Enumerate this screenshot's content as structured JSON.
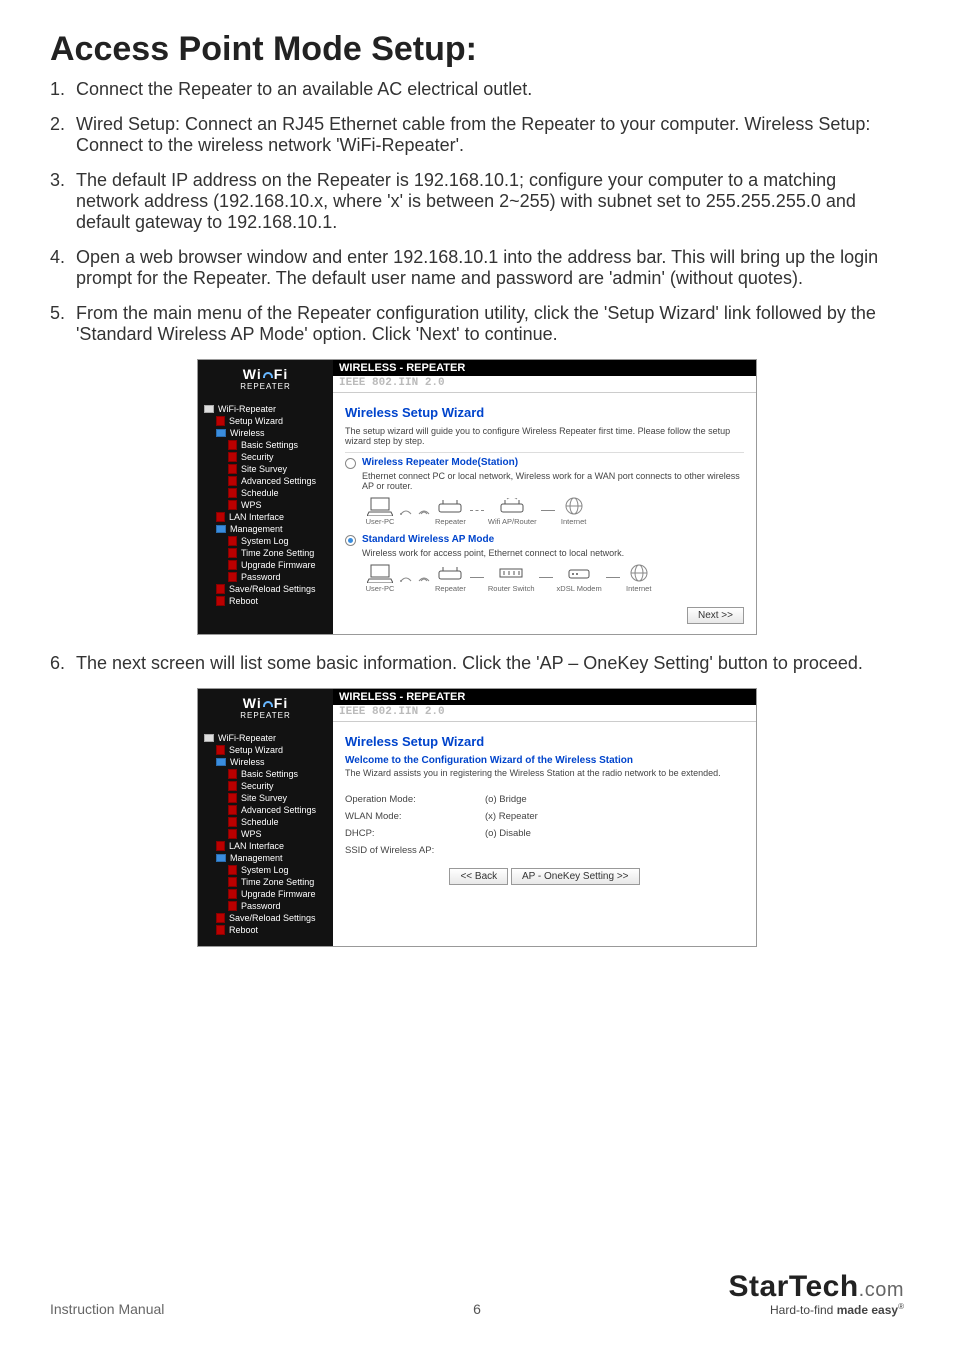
{
  "heading": "Access Point Mode Setup:",
  "steps": [
    "Connect the Repeater to an available AC electrical outlet.",
    "Wired Setup: Connect an RJ45 Ethernet cable from the Repeater to your computer. Wireless Setup: Connect to the wireless network 'WiFi-Repeater'.",
    "The default IP address on the Repeater is 192.168.10.1; configure your computer to a matching network address (192.168.10.x, where 'x' is between 2~255) with subnet set to 255.255.255.0 and default gateway to 192.168.10.1.",
    "Open a web browser window and enter 192.168.10.1 into the address bar.  This will bring up the login prompt for the Repeater.  The default user name and password are 'admin' (without quotes).",
    "From the main menu of the Repeater configuration utility, click the 'Setup Wizard' link followed by the 'Standard Wireless AP Mode' option.  Click 'Next' to continue.",
    "The next screen will list some basic information.  Click the 'AP – OneKey Setting' button to proceed."
  ],
  "router_ui": {
    "logo_top": "Wi Fi",
    "logo_bottom": "REPEATER",
    "header_top": "WIRELESS - REPEATER",
    "header_sub": "IEEE 802.IIN 2.0",
    "nav": {
      "root": "WiFi-Repeater",
      "items": [
        {
          "label": "Setup Wizard",
          "lvl": 2,
          "icon": "file"
        },
        {
          "label": "Wireless",
          "lvl": 2,
          "icon": "folder"
        },
        {
          "label": "Basic Settings",
          "lvl": 3,
          "icon": "file"
        },
        {
          "label": "Security",
          "lvl": 3,
          "icon": "file"
        },
        {
          "label": "Site Survey",
          "lvl": 3,
          "icon": "file"
        },
        {
          "label": "Advanced Settings",
          "lvl": 3,
          "icon": "file"
        },
        {
          "label": "Schedule",
          "lvl": 3,
          "icon": "file"
        },
        {
          "label": "WPS",
          "lvl": 3,
          "icon": "file"
        },
        {
          "label": "LAN Interface",
          "lvl": 2,
          "icon": "file"
        },
        {
          "label": "Management",
          "lvl": 2,
          "icon": "folder"
        },
        {
          "label": "System Log",
          "lvl": 3,
          "icon": "file"
        },
        {
          "label": "Time Zone Setting",
          "lvl": 3,
          "icon": "file"
        },
        {
          "label": "Upgrade Firmware",
          "lvl": 3,
          "icon": "file"
        },
        {
          "label": "Password",
          "lvl": 3,
          "icon": "file"
        },
        {
          "label": "Save/Reload Settings",
          "lvl": 2,
          "icon": "file"
        },
        {
          "label": "Reboot",
          "lvl": 2,
          "icon": "file"
        }
      ]
    }
  },
  "screen1": {
    "title": "Wireless Setup Wizard",
    "desc": "The setup wizard will guide you to configure Wireless Repeater first time. Please follow the setup wizard step by step.",
    "opt1_title": "Wireless Repeater Mode(Station)",
    "opt1_desc": "Ethernet connect PC or local network, Wireless work for a WAN port connects to other wireless AP or router.",
    "diag1": [
      "User-PC",
      "Repeater",
      "Wifi AP/Router",
      "Internet"
    ],
    "opt2_title": "Standard Wireless AP Mode",
    "opt2_desc": "Wireless work for access point, Ethernet connect to local network.",
    "diag2": [
      "User-PC",
      "Repeater",
      "Router Switch",
      "xDSL Modem",
      "Internet"
    ],
    "next_btn": "Next >>"
  },
  "screen2": {
    "title": "Wireless Setup Wizard",
    "welcome": "Welcome to the Configuration Wizard of the Wireless Station",
    "desc": "The Wizard assists you in registering the Wireless Station at the radio network to be extended.",
    "rows": [
      {
        "k": "Operation Mode:",
        "v": "(o) Bridge"
      },
      {
        "k": "WLAN Mode:",
        "v": "(x) Repeater"
      },
      {
        "k": "DHCP:",
        "v": "(o) Disable"
      },
      {
        "k": "SSID of Wireless AP:",
        "v": ""
      }
    ],
    "back_btn": "<< Back",
    "apply_btn": "AP - OneKey Setting >>"
  },
  "footer": {
    "manual": "Instruction Manual",
    "page": "6",
    "brand": "StarTech",
    "dotcom": ".com",
    "tagline_pre": "Hard-to-find ",
    "tagline_bold": "made easy"
  }
}
